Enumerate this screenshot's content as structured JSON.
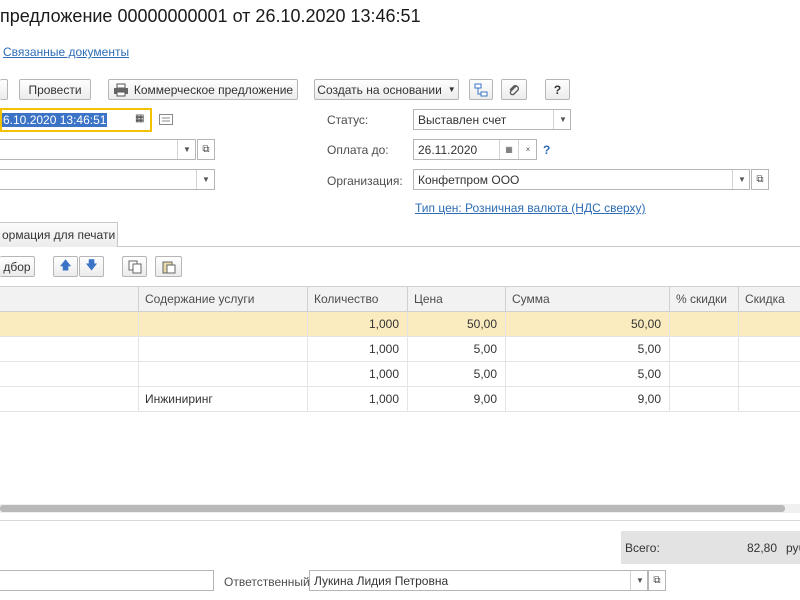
{
  "header": {
    "title": " предложение 00000000001 от 26.10.2020 13:46:51",
    "related_docs": "Связанные документы"
  },
  "toolbar": {
    "post_label": "Провести",
    "print_label": "Коммерческое предложение",
    "create_based_label": "Создать на основании",
    "help_label": "?"
  },
  "form": {
    "date_value": "6.10.2020 13:46:51",
    "status_label": "Статус:",
    "status_value": "Выставлен счет",
    "pay_until_label": "Оплата до:",
    "pay_until_value": "26.11.2020",
    "pay_help": "?",
    "org_label": "Организация:",
    "org_value": "Конфетпром ООО",
    "price_type_link": "Тип цен: Розничная валюта (НДС сверху)"
  },
  "tabs": {
    "print_info": "ормация для печати"
  },
  "table_toolbar": {
    "pick_label": "дбор"
  },
  "table": {
    "columns": [
      "Содержание услуги",
      "Количество",
      "Цена",
      "Сумма",
      "% скидки",
      "Скидка"
    ],
    "rows": [
      {
        "service": "",
        "qty": "1,000",
        "price": "50,00",
        "sum": "50,00",
        "disc_pct": "",
        "disc": ""
      },
      {
        "service": "",
        "qty": "1,000",
        "price": "5,00",
        "sum": "5,00",
        "disc_pct": "",
        "disc": ""
      },
      {
        "service": "",
        "qty": "1,000",
        "price": "5,00",
        "sum": "5,00",
        "disc_pct": "",
        "disc": ""
      },
      {
        "service": "Инжиниринг",
        "qty": "1,000",
        "price": "9,00",
        "sum": "9,00",
        "disc_pct": "",
        "disc": ""
      }
    ]
  },
  "footer": {
    "total_label": "Всего:",
    "total_value": "82,80",
    "total_currency": "руб",
    "responsible_label": "Ответственный:",
    "responsible_value": "Лукина Лидия Петровна"
  },
  "colors": {
    "accent_link": "#2d6cb5",
    "focus_border": "#f2c200",
    "selected_row": "#fbecc0",
    "selection_bg": "#3b74c6"
  }
}
